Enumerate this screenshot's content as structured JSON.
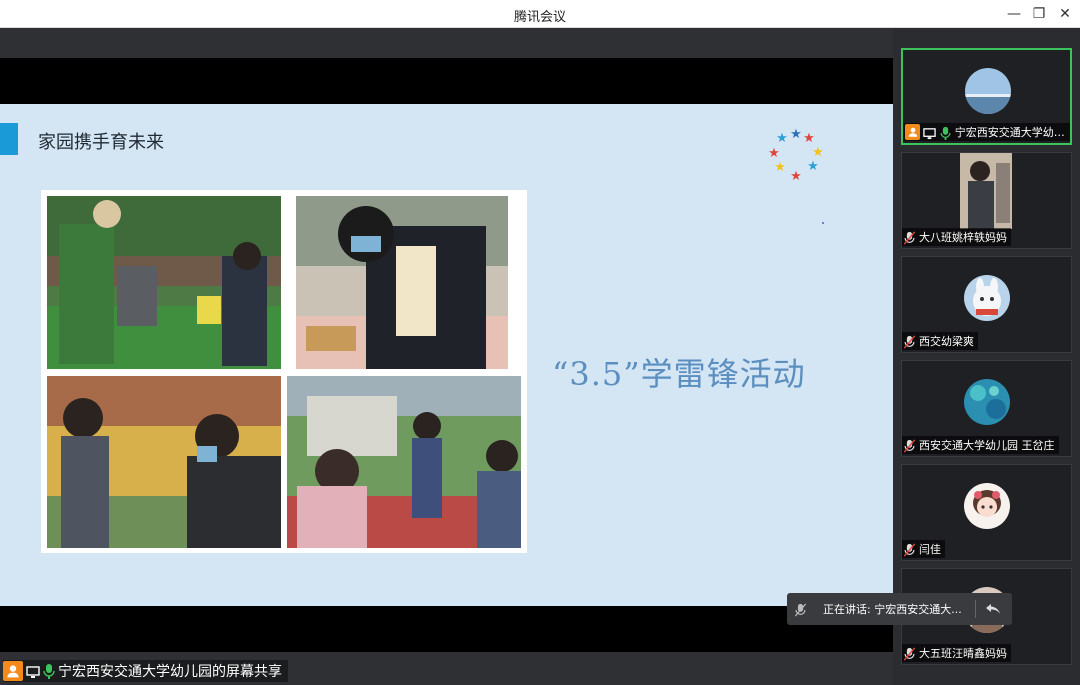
{
  "window": {
    "title": "腾讯会议",
    "min_label": "—",
    "max_label": "❐",
    "close_label": "✕"
  },
  "slide": {
    "heading": "家园携手育未来",
    "slogan": "“3.5”学雷锋活动"
  },
  "share": {
    "label": "宁宏西安交通大学幼儿园的屏幕共享"
  },
  "participants": [
    {
      "name": "宁宏西安交通大学幼儿...",
      "status": "speaking-host"
    },
    {
      "name": "大八班姚梓轶妈妈",
      "status": "muted"
    },
    {
      "name": "西交幼梁爽",
      "status": "muted"
    },
    {
      "name": "西安交通大学幼儿园 王岔庄",
      "status": "muted"
    },
    {
      "name": "闫佳",
      "status": "muted"
    },
    {
      "name": "大五班汪晴鑫妈妈",
      "status": "muted"
    }
  ],
  "toast": {
    "speaking_text": "正在讲话: 宁宏西安交通大..."
  },
  "colors": {
    "accent_blue": "#1a9ad6",
    "active_green": "#3cc35c",
    "host_orange": "#f28b1c",
    "slide_bg": "#d4e5f4"
  }
}
